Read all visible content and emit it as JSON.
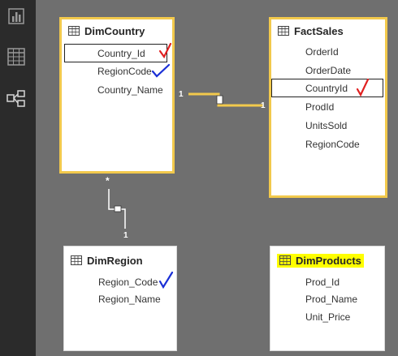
{
  "rail": {
    "items": [
      {
        "name": "report-view",
        "icon": "bar-chart-icon"
      },
      {
        "name": "data-view",
        "icon": "table-grid-icon"
      },
      {
        "name": "relationships-view",
        "icon": "model-diagram-icon"
      }
    ]
  },
  "tables": {
    "dim_country": {
      "title": "DimCountry",
      "fields": [
        "Country_Id",
        "RegionCode",
        "Country_Name"
      ]
    },
    "fact_sales": {
      "title": "FactSales",
      "fields": [
        "OrderId",
        "OrderDate",
        "CountryId",
        "ProdId",
        "UnitsSold",
        "RegionCode"
      ]
    },
    "dim_region": {
      "title": "DimRegion",
      "fields": [
        "Region_Code",
        "Region_Name"
      ]
    },
    "dim_products": {
      "title": "DimProducts",
      "fields": [
        "Prod_Id",
        "Prod_Name",
        "Unit_Price"
      ]
    }
  },
  "relationships": {
    "country_sales": {
      "left_cardinality": "1",
      "right_cardinality": "1"
    },
    "country_region": {
      "top_cardinality": "*",
      "bottom_cardinality": "1"
    }
  },
  "colors": {
    "canvas": "#6f6f6f",
    "rail": "#2b2b2b",
    "selected_border": "#f2c94c",
    "highlight": "#ffff00",
    "red_check": "#e02020",
    "blue_check": "#1a2fd6"
  }
}
